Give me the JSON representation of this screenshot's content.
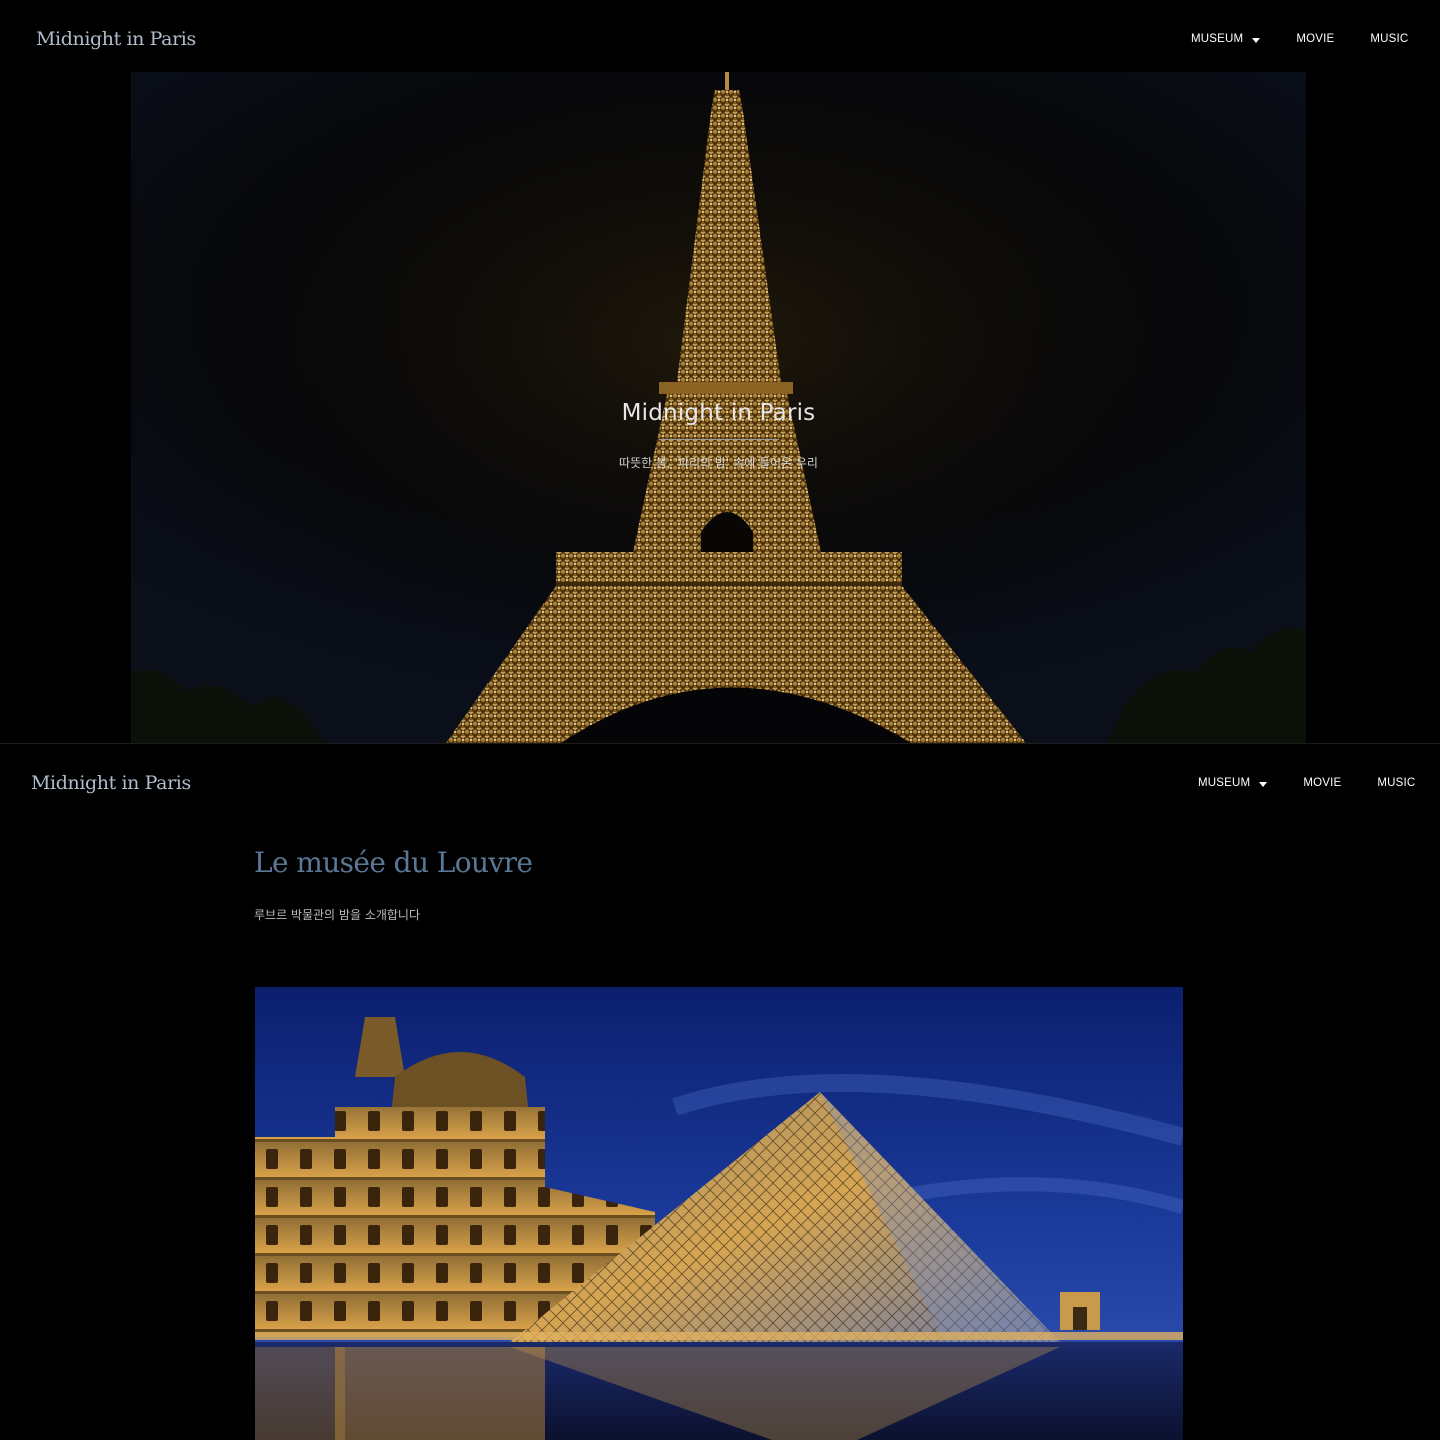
{
  "screens": [
    {
      "navbar": {
        "brand": "Midnight in Paris",
        "menu": [
          {
            "label": "MUSEUM",
            "has_dropdown": true
          },
          {
            "label": "MOVIE",
            "has_dropdown": false
          },
          {
            "label": "MUSIC",
            "has_dropdown": false
          }
        ]
      },
      "hero": {
        "title": "Midnight in Paris",
        "subtitle": "따뜻한 봄, '파리의 밤' 속에 들어온 우리",
        "image": "eiffel-tower-night-photo"
      }
    },
    {
      "navbar": {
        "brand": "Midnight in Paris",
        "menu": [
          {
            "label": "MUSEUM",
            "has_dropdown": true
          },
          {
            "label": "MOVIE",
            "has_dropdown": false
          },
          {
            "label": "MUSIC",
            "has_dropdown": false
          }
        ]
      },
      "section": {
        "title": "Le musée du Louvre",
        "description": "루브르 박물관의 밤을 소개합니다",
        "image": "louvre-pyramid-night-photo"
      }
    }
  ],
  "colors": {
    "background": "#000000",
    "brand_text": "#aebccb",
    "section_title": "#5a7896",
    "nav_text": "#ffffff"
  }
}
